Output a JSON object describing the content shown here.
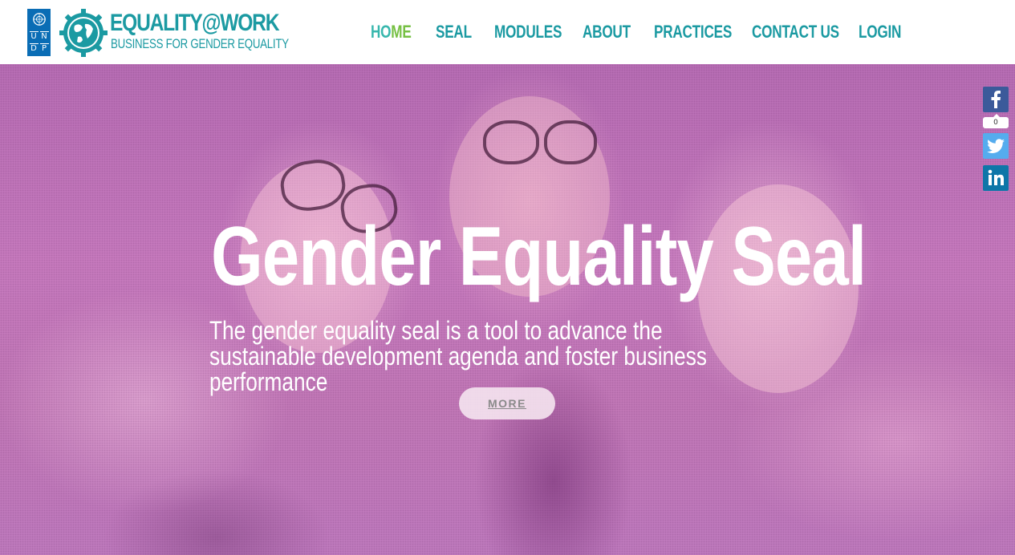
{
  "logos": {
    "undp_letters": [
      "U",
      "N",
      "D",
      "P"
    ],
    "brand_title": "EQUALITY@WORK",
    "brand_subtitle": "BUSINESS FOR GENDER EQUALITY"
  },
  "nav": {
    "items": [
      {
        "label": "HOME",
        "active": true
      },
      {
        "label": "SEAL"
      },
      {
        "label": "MODULES"
      },
      {
        "label": "ABOUT"
      },
      {
        "label": "PRACTICES"
      },
      {
        "label": "CONTACT US"
      },
      {
        "label": "LOGIN"
      }
    ]
  },
  "hero": {
    "title": "Gender Equality Seal",
    "description": "The gender equality seal is a tool to advance the sustainable development agenda and foster business performance",
    "more_label": "MORE"
  },
  "social": {
    "facebook_count": "0",
    "icons": [
      "facebook-icon",
      "twitter-icon",
      "linkedin-icon"
    ]
  },
  "colors": {
    "brand_teal": "#1b9aa2",
    "active_green": "#76c043",
    "undp_blue": "#0a6db5",
    "hero_overlay": "#c17cc0"
  }
}
